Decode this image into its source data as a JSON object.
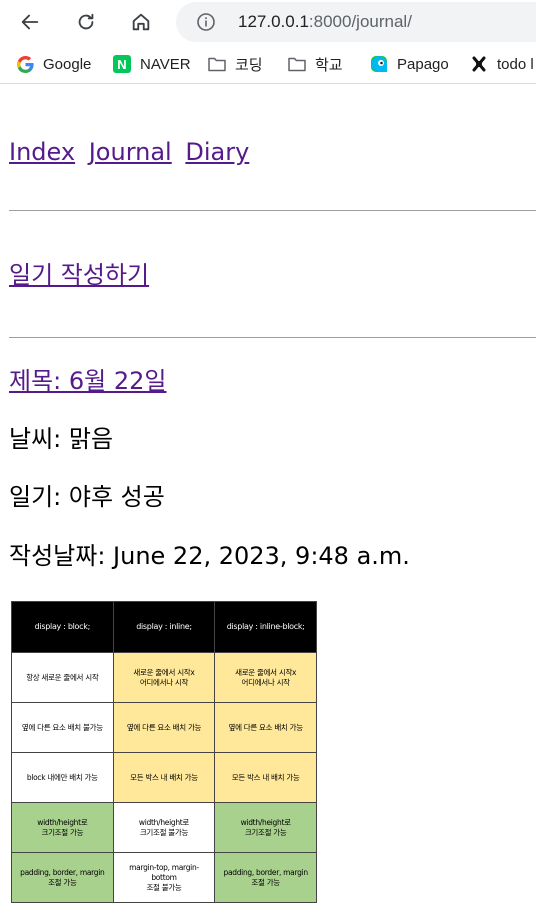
{
  "browser": {
    "url_host": "127.0.0.1",
    "url_rest": ":8000/journal/",
    "bookmarks": [
      {
        "label": "Google",
        "icon": "google-icon"
      },
      {
        "label": "NAVER",
        "icon": "naver-icon",
        "icon_text": "N"
      },
      {
        "label": "코딩",
        "icon": "folder-icon"
      },
      {
        "label": "학교",
        "icon": "folder-icon"
      },
      {
        "label": "Papago",
        "icon": "papago-icon"
      },
      {
        "label": "todo l",
        "icon": "notion-icon"
      }
    ]
  },
  "page": {
    "nav": [
      "Index",
      "Journal",
      "Diary"
    ],
    "write_link": "일기 작성하기",
    "entry": {
      "title": "제목: 6월 22일",
      "weather": "날씨: 맑음",
      "diary": "일기: 야후 성공",
      "date": "작성날짜: June 22, 2023, 9:48 a.m."
    },
    "image_table": {
      "headers": [
        "display : block;",
        "display : inline;",
        "display : inline-block;"
      ],
      "rows": [
        {
          "cells": [
            "항상 새로운 줄에서 시작",
            "새로운 줄에서 시작x\n어디에서나 시작",
            "새로운 줄에서 시작x\n어디에서나 시작"
          ],
          "colors": [
            "white",
            "yellow",
            "yellow"
          ]
        },
        {
          "cells": [
            "옆에 다른 요소 배치 불가능",
            "옆에 다른 요소 배치 가능",
            "옆에 다른 요소 배치 가능"
          ],
          "colors": [
            "white",
            "yellow",
            "yellow"
          ]
        },
        {
          "cells": [
            "block 내에만 배치 가능",
            "모든 박스 내 배치 가능",
            "모든 박스 내 배치 가능"
          ],
          "colors": [
            "white",
            "yellow",
            "yellow"
          ]
        },
        {
          "cells": [
            "width/height로\n크기조절 가능",
            "width/height로\n크기조절 불가능",
            "width/height로\n크기조절 가능"
          ],
          "colors": [
            "green",
            "white",
            "green"
          ]
        },
        {
          "cells": [
            "padding, border, margin\n조절 가능",
            "margin-top, margin-bottom\n조절 불가능",
            "padding, border, margin\n조절 가능"
          ],
          "colors": [
            "green",
            "white",
            "green"
          ]
        }
      ]
    }
  },
  "colors": {
    "link_visited": "#551a8b",
    "omnibox_bg": "#f1f3f4",
    "table_header_bg": "#000000",
    "table_yellow": "#ffe89a",
    "table_green": "#a9d18e"
  }
}
